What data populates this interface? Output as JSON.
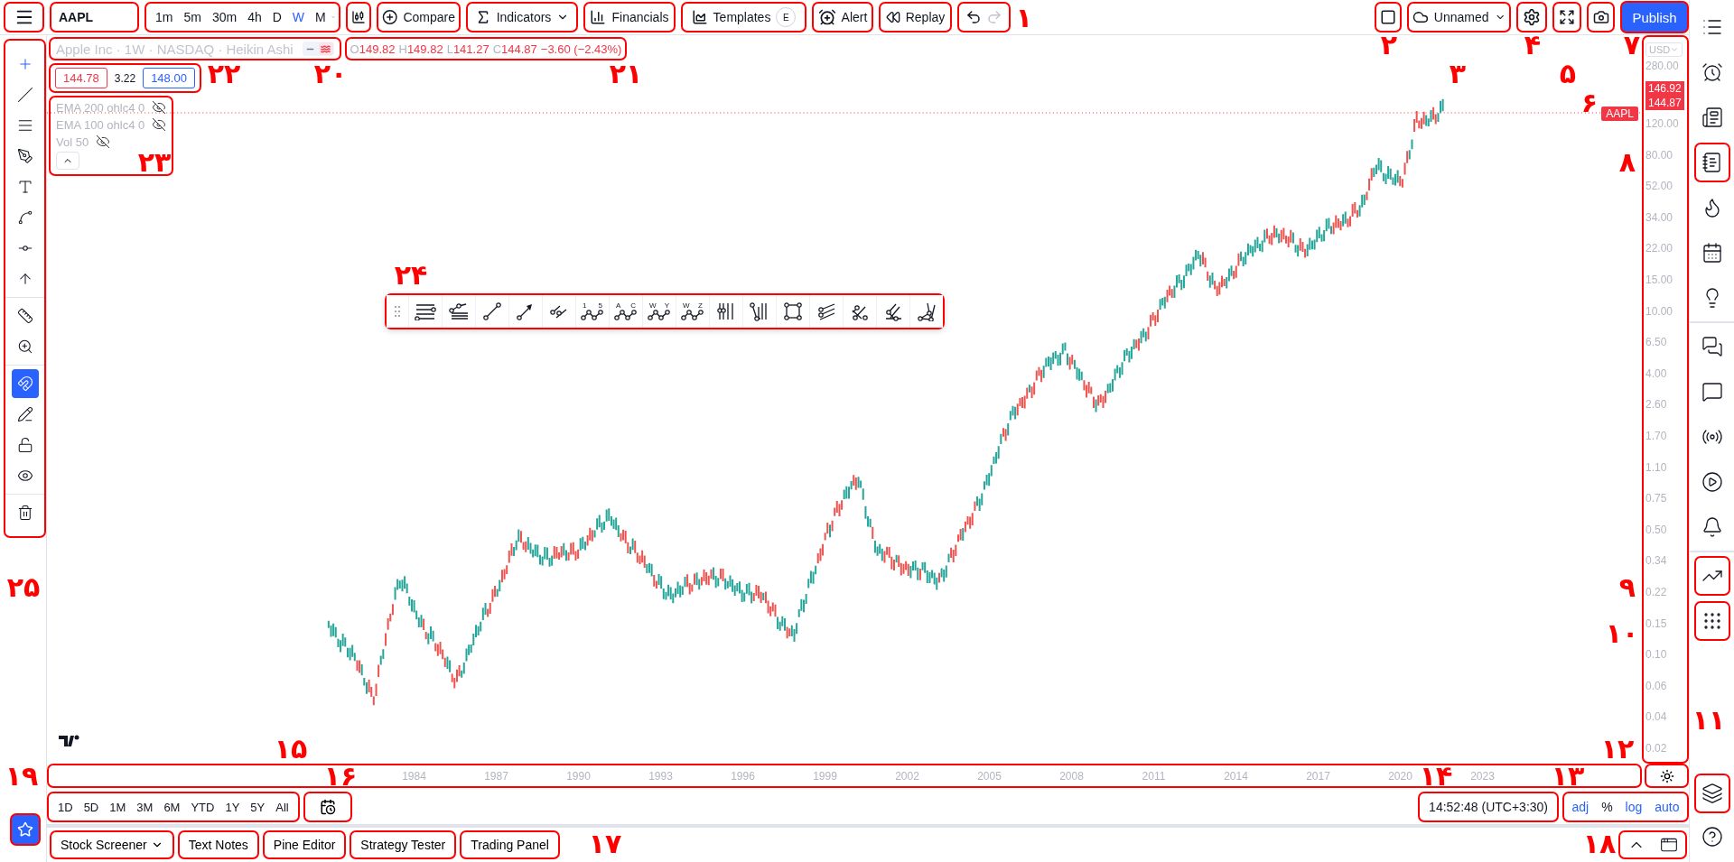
{
  "header": {
    "symbol": "AAPL",
    "intervals": [
      {
        "label": "1m",
        "selected": false
      },
      {
        "label": "5m",
        "selected": false
      },
      {
        "label": "30m",
        "selected": false
      },
      {
        "label": "4h",
        "selected": false
      },
      {
        "label": "D",
        "selected": false
      },
      {
        "label": "W",
        "selected": true
      },
      {
        "label": "M",
        "selected": false
      }
    ],
    "compare": "Compare",
    "indicators": "Indicators",
    "financials": "Financials",
    "templates": "Templates",
    "templates_badge": "E",
    "alert": "Alert",
    "replay": "Replay",
    "layout_name": "Unnamed",
    "publish": "Publish"
  },
  "left_toolbar": {
    "groups": [
      [
        {
          "kind": "crosshair",
          "active": false
        },
        {
          "kind": "trend-line",
          "active": false
        },
        {
          "kind": "fib",
          "active": false
        },
        {
          "kind": "brush",
          "active": false
        },
        {
          "kind": "text",
          "active": false
        },
        {
          "kind": "pattern",
          "active": false
        },
        {
          "kind": "forecast",
          "active": false
        },
        {
          "kind": "arrow",
          "active": false
        }
      ],
      [
        {
          "kind": "ruler",
          "active": false
        },
        {
          "kind": "zoom",
          "active": false
        }
      ],
      [
        {
          "kind": "magnet",
          "active": true
        },
        {
          "kind": "pencil",
          "active": false
        },
        {
          "kind": "lock",
          "active": false
        },
        {
          "kind": "eye",
          "active": false
        }
      ],
      [
        {
          "kind": "trash",
          "active": false
        }
      ]
    ]
  },
  "legend": {
    "title": "Apple Inc · 1W · NASDAQ · Heikin Ashi",
    "display_modes": [
      {
        "kind": "line",
        "selected": false
      },
      {
        "kind": "wave",
        "selected": true
      }
    ],
    "ohlc": [
      {
        "key": "O",
        "value": "149.82"
      },
      {
        "key": "H",
        "value": "149.82"
      },
      {
        "key": "L",
        "value": "141.27"
      },
      {
        "key": "C",
        "value": "144.87"
      }
    ],
    "change": "−3.60 (−2.43%)",
    "bid": "144.78",
    "spread": "3.22",
    "ask": "148.00",
    "studies": [
      {
        "label": "EMA 200 ohlc4 0"
      },
      {
        "label": "EMA 100 ohlc4 0"
      },
      {
        "label": "Vol 50"
      }
    ]
  },
  "drawing_tools": [
    {
      "kind": "grip"
    },
    {
      "kind": "hlines"
    },
    {
      "kind": "fib-fan"
    },
    {
      "kind": "line"
    },
    {
      "kind": "arrow"
    },
    {
      "kind": "parallel"
    },
    {
      "kind": "zigzag",
      "letters": [
        "1",
        "5"
      ]
    },
    {
      "kind": "zigzag",
      "letters": [
        "A",
        "C"
      ]
    },
    {
      "kind": "zigzag",
      "letters": [
        "W",
        "Y"
      ]
    },
    {
      "kind": "zigzag",
      "letters": [
        "W",
        "Z"
      ]
    },
    {
      "kind": "vlines"
    },
    {
      "kind": "pitchfork"
    },
    {
      "kind": "rectangle"
    },
    {
      "kind": "channel"
    },
    {
      "kind": "gann"
    },
    {
      "kind": "schiff"
    },
    {
      "kind": "triangle"
    }
  ],
  "chart": {
    "symbol_label": "AAPL"
  },
  "price_axis": {
    "currency": "USD",
    "upper_ticks": [
      "280.00"
    ],
    "badges": [
      "146.92",
      "144.87"
    ],
    "ticks": [
      "120.00",
      "80.00",
      "52.00",
      "34.00",
      "22.00",
      "15.00",
      "10.00",
      "6.50",
      "4.00",
      "2.60",
      "1.70",
      "1.10",
      "0.75",
      "0.50",
      "0.34",
      "0.22",
      "0.15",
      "0.10",
      "0.06",
      "0.04",
      "0.02"
    ]
  },
  "time_axis": {
    "labels": [
      "1984",
      "1987",
      "1990",
      "1993",
      "1996",
      "1999",
      "2002",
      "2005",
      "2008",
      "2011",
      "2014",
      "2017",
      "2020",
      "2023"
    ]
  },
  "range_bar": {
    "ranges": [
      "1D",
      "5D",
      "1M",
      "3M",
      "6M",
      "YTD",
      "1Y",
      "5Y",
      "All"
    ],
    "clock": "14:52:48 (UTC+3:30)",
    "scale_options": [
      {
        "label": "adj",
        "active": true
      },
      {
        "label": "%",
        "active": false
      },
      {
        "label": "log",
        "active": true
      },
      {
        "label": "auto",
        "active": true
      }
    ]
  },
  "bottom_tabs": [
    {
      "label": "Stock Screener",
      "dropdown": true
    },
    {
      "label": "Text Notes",
      "dropdown": false
    },
    {
      "label": "Pine Editor",
      "dropdown": false
    },
    {
      "label": "Strategy Tester",
      "dropdown": false
    },
    {
      "label": "Trading Panel",
      "dropdown": false
    }
  ],
  "right_sidebar": {
    "groups": [
      [
        {
          "kind": "watchlist",
          "framed": false
        },
        {
          "kind": "alarm",
          "framed": false
        },
        {
          "kind": "news",
          "framed": false
        },
        {
          "kind": "notes",
          "framed": true
        },
        {
          "kind": "flame",
          "framed": false
        },
        {
          "kind": "calendar",
          "framed": false
        },
        {
          "kind": "idea",
          "framed": false
        }
      ],
      [
        {
          "kind": "chats",
          "framed": false
        },
        {
          "kind": "chat",
          "framed": false
        },
        {
          "kind": "broadcast-idea",
          "framed": false
        },
        {
          "kind": "stream",
          "framed": false
        },
        {
          "kind": "bell",
          "framed": false
        }
      ],
      [
        {
          "kind": "trend",
          "framed": true
        },
        {
          "kind": "dom",
          "framed": true
        }
      ]
    ],
    "bottom": [
      {
        "kind": "layers",
        "framed": true
      },
      {
        "kind": "help",
        "framed": false
      }
    ]
  },
  "annotations": [
    {
      "label": "۱"
    },
    {
      "label": "۷"
    },
    {
      "label": "۴"
    },
    {
      "label": "۲"
    },
    {
      "label": "۵"
    },
    {
      "label": "۳"
    },
    {
      "label": "۲۱"
    },
    {
      "label": "۲۰"
    },
    {
      "label": "۲۲"
    },
    {
      "label": "۶"
    },
    {
      "label": "۸"
    },
    {
      "label": "۲۳"
    },
    {
      "label": "۲۴"
    },
    {
      "label": "۹"
    },
    {
      "label": "۲۵"
    },
    {
      "label": "۱۰"
    },
    {
      "label": "۱۱"
    },
    {
      "label": "۱۲"
    },
    {
      "label": "۱۵"
    },
    {
      "label": "۱۳"
    },
    {
      "label": "۱۴"
    },
    {
      "label": "۱۶"
    },
    {
      "label": "۱۹"
    },
    {
      "label": "۱۸"
    },
    {
      "label": "۱۷"
    }
  ]
}
